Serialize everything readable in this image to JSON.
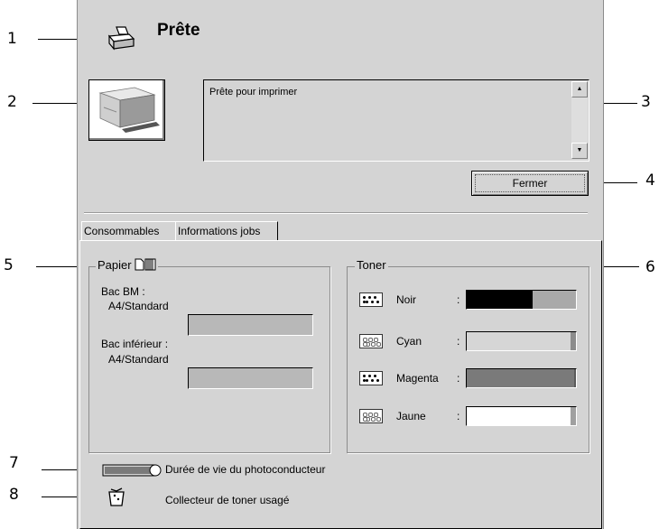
{
  "callouts": [
    "1",
    "2",
    "3",
    "4",
    "5",
    "6",
    "7",
    "8"
  ],
  "status": {
    "title": "Prête",
    "message": "Prête pour imprimer",
    "close_label": "Fermer"
  },
  "tabs": [
    {
      "label": "Consommables",
      "active": true
    },
    {
      "label": "Informations jobs",
      "active": false
    }
  ],
  "paper": {
    "legend": "Papier",
    "trays": [
      {
        "name": "Bac BM :",
        "size": "A4/Standard"
      },
      {
        "name": "Bac inférieur :",
        "size": "A4/Standard"
      }
    ]
  },
  "toner": {
    "legend": "Toner",
    "items": [
      {
        "name": "Noir",
        "level": 0.6,
        "color": "#000000",
        "empty": "#a9a9a9"
      },
      {
        "name": "Cyan",
        "level": 0.95,
        "color": "#d6d6d6",
        "empty": "#8c8c8c"
      },
      {
        "name": "Magenta",
        "level": 0.98,
        "color": "#7a7a7a",
        "empty": "#5a5a5a"
      },
      {
        "name": "Jaune",
        "level": 0.95,
        "color": "#ffffff",
        "empty": "#a0a0a0"
      }
    ]
  },
  "photoconductor_label": "Durée de vie du photoconducteur",
  "waste_toner_label": "Collecteur de toner usagé",
  "icons": [
    "printer-icon",
    "printer-image",
    "paper-icon",
    "toner-icon",
    "photoconductor-icon",
    "waste-toner-icon"
  ]
}
